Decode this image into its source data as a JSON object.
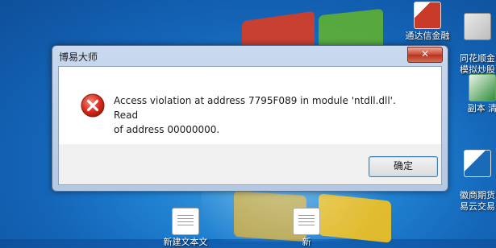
{
  "desktop": {
    "icons": [
      {
        "label": "通达信金融"
      },
      {
        "label": "同花顺金\n模拟炒股"
      },
      {
        "label": "副本 清"
      },
      {
        "label": "徽商期货\n易云交易"
      },
      {
        "label": "新建文本文"
      },
      {
        "label": "新"
      }
    ]
  },
  "dialog": {
    "title": "博易大师",
    "close_label": "✕",
    "message_line1": "Access violation at address 7795F089 in module 'ntdll.dll'. Read",
    "message_line2": "of address 00000000.",
    "ok_label": "确定"
  }
}
